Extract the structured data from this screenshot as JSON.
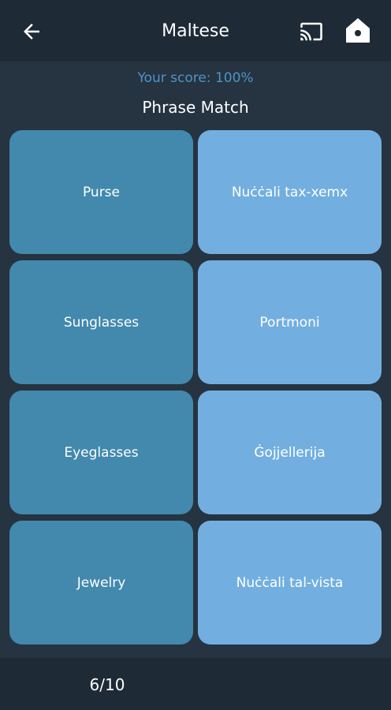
{
  "header": {
    "title": "Maltese",
    "back_icon": "arrow-left-icon",
    "cast_icon": "cast-icon",
    "home_icon": "home-icon"
  },
  "score_text": "Your score: 100%",
  "game_title": "Phrase Match",
  "tiles": {
    "left": [
      "Purse",
      "Sunglasses",
      "Eyeglasses",
      "Jewelry"
    ],
    "right": [
      "Nuċċali tax-xemx",
      "Portmoni",
      "Ġojjellerija",
      "Nuċċali tal-vista"
    ]
  },
  "footer": {
    "progress": "6/10"
  },
  "colors": {
    "background": "#263340",
    "bar": "#1e2a36",
    "left_tile": "#4289ad",
    "right_tile": "#72afe0",
    "score_text": "#4d95c9"
  }
}
